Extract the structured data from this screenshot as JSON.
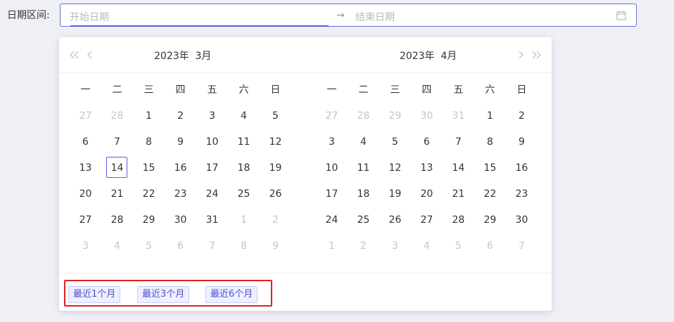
{
  "field": {
    "label": "日期区间:",
    "start_placeholder": "开始日期",
    "separator": "→",
    "end_placeholder": "结束日期"
  },
  "colors": {
    "accent": "#5b5fd6",
    "highlight_border": "#e0201f",
    "muted_text": "#c4c4c4"
  },
  "calendars": {
    "left": {
      "title": "2023年  3月",
      "weekdays": [
        "一",
        "二",
        "三",
        "四",
        "五",
        "六",
        "日"
      ],
      "weeks": [
        [
          "27",
          "28",
          "1",
          "2",
          "3",
          "4",
          "5"
        ],
        [
          "6",
          "7",
          "8",
          "9",
          "10",
          "11",
          "12"
        ],
        [
          "13",
          "14",
          "15",
          "16",
          "17",
          "18",
          "19"
        ],
        [
          "20",
          "21",
          "22",
          "23",
          "24",
          "25",
          "26"
        ],
        [
          "27",
          "28",
          "29",
          "30",
          "31",
          "1",
          "2"
        ],
        [
          "3",
          "4",
          "5",
          "6",
          "7",
          "8",
          "9"
        ]
      ],
      "muted": [
        [
          0,
          0
        ],
        [
          0,
          1
        ],
        [
          4,
          5
        ],
        [
          4,
          6
        ],
        [
          5,
          0
        ],
        [
          5,
          1
        ],
        [
          5,
          2
        ],
        [
          5,
          3
        ],
        [
          5,
          4
        ],
        [
          5,
          5
        ],
        [
          5,
          6
        ]
      ],
      "today": [
        2,
        1
      ]
    },
    "right": {
      "title": "2023年  4月",
      "weekdays": [
        "一",
        "二",
        "三",
        "四",
        "五",
        "六",
        "日"
      ],
      "weeks": [
        [
          "27",
          "28",
          "29",
          "30",
          "31",
          "1",
          "2"
        ],
        [
          "3",
          "4",
          "5",
          "6",
          "7",
          "8",
          "9"
        ],
        [
          "10",
          "11",
          "12",
          "13",
          "14",
          "15",
          "16"
        ],
        [
          "17",
          "18",
          "19",
          "20",
          "21",
          "22",
          "23"
        ],
        [
          "24",
          "25",
          "26",
          "27",
          "28",
          "29",
          "30"
        ],
        [
          "1",
          "2",
          "3",
          "4",
          "5",
          "6",
          "7"
        ]
      ],
      "muted": [
        [
          0,
          0
        ],
        [
          0,
          1
        ],
        [
          0,
          2
        ],
        [
          0,
          3
        ],
        [
          0,
          4
        ],
        [
          5,
          0
        ],
        [
          5,
          1
        ],
        [
          5,
          2
        ],
        [
          5,
          3
        ],
        [
          5,
          4
        ],
        [
          5,
          5
        ],
        [
          5,
          6
        ]
      ],
      "today": null
    }
  },
  "presets": [
    "最近1个月",
    "最近3个月",
    "最近6个月"
  ],
  "icons": {
    "prev_year": "double-chevron-left-icon",
    "prev_month": "chevron-left-icon",
    "next_month": "chevron-right-icon",
    "next_year": "double-chevron-right-icon",
    "calendar": "calendar-icon"
  }
}
